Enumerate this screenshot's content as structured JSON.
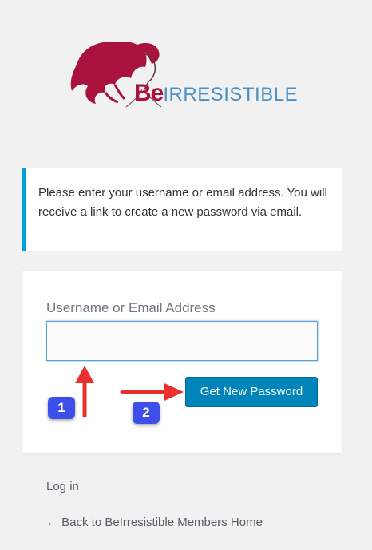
{
  "logo": {
    "icon_name": "woman-silhouette-logo",
    "text_be": "Be",
    "text_rest": "IRRESISTIBLE",
    "be_color": "#a8123c",
    "rest_color": "#4a90c8"
  },
  "message": {
    "text": "Please enter your username or email address. You will receive a link to create a new password via email.",
    "accent_color": "#00a0d2"
  },
  "form": {
    "username_label": "Username or Email Address",
    "username_value": "",
    "submit_label": "Get New Password",
    "button_color": "#0085ba"
  },
  "annotations": {
    "badge_1": "1",
    "badge_2": "2",
    "arrow_color": "#e8302c",
    "badge_color": "#3d4fe8"
  },
  "nav": {
    "login_label": "Log in",
    "back_label": "← Back to BeIrresistible Members Home"
  }
}
